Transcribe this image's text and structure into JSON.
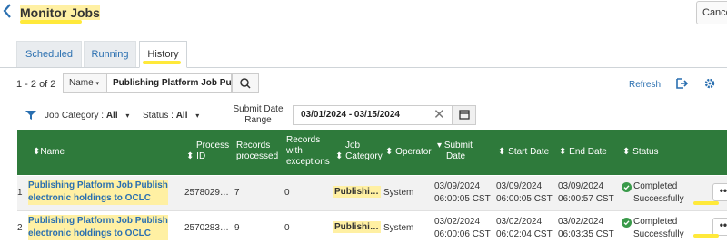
{
  "header": {
    "title": "Monitor Jobs",
    "cancel_label": "Cance"
  },
  "tabs": [
    {
      "label": "Scheduled",
      "active": false
    },
    {
      "label": "Running",
      "active": false
    },
    {
      "label": "History",
      "active": true
    }
  ],
  "toolbar": {
    "count_text": "1 - 2 of 2",
    "field_label": "Name",
    "search_value": "Publishing Platform Job Publ",
    "refresh_label": "Refresh"
  },
  "filters": {
    "job_category_label": "Job Category :",
    "job_category_value": "All",
    "status_label": "Status :",
    "status_value": "All",
    "submit_date_label_line1": "Submit Date",
    "submit_date_label_line2": "Range",
    "date_range": "03/01/2024 - 03/15/2024"
  },
  "table": {
    "columns": {
      "name": "Name",
      "process_id_1": "Process",
      "process_id_2": "ID",
      "records_processed_1": "Records",
      "records_processed_2": "processed",
      "records_exceptions_1": "Records",
      "records_exceptions_2": "with",
      "records_exceptions_3": "exceptions",
      "job_category_1": "Job",
      "job_category_2": "Category",
      "operator": "Operator",
      "submit_date_1": "Submit",
      "submit_date_2": "Date",
      "start_date": "Start Date",
      "end_date": "End Date",
      "status": "Status"
    },
    "rows": [
      {
        "num": "1",
        "name_line1": "Publishing Platform Job Publish",
        "name_line2": "electronic holdings to OCLC",
        "process_id": "2578029…",
        "records_processed": "7",
        "records_exceptions": "0",
        "job_category": "Publishi…",
        "operator": "System",
        "submit_date_1": "03/09/2024",
        "submit_date_2": "06:00:05 CST",
        "start_date_1": "03/09/2024",
        "start_date_2": "06:00:05 CST",
        "end_date_1": "03/09/2024",
        "end_date_2": "06:00:57 CST",
        "status_1": "Completed",
        "status_2": "Successfully",
        "more_label": "•••"
      },
      {
        "num": "2",
        "name_line1": "Publishing Platform Job Publish",
        "name_line2": "electronic holdings to OCLC",
        "process_id": "2570283…",
        "records_processed": "9",
        "records_exceptions": "0",
        "job_category": "Publishi…",
        "operator": "System",
        "submit_date_1": "03/02/2024",
        "submit_date_2": "06:00:06 CST",
        "start_date_1": "03/02/2024",
        "start_date_2": "06:02:04 CST",
        "end_date_1": "03/02/2024",
        "end_date_2": "06:03:35 CST",
        "status_1": "Completed",
        "status_2": "Successfully",
        "more_label": "•••"
      }
    ]
  },
  "colors": {
    "header_green": "#2e7a3b",
    "link_blue": "#2a6fb0",
    "highlight": "#fff0a3",
    "highlight_marker": "#ffe93a",
    "success_green": "#3a9a4a"
  },
  "icons": {
    "back": "chevron-left-icon",
    "search": "search-icon",
    "export": "export-icon",
    "settings": "gear-icon",
    "filter": "filter-icon",
    "clear": "close-icon",
    "calendar": "calendar-icon",
    "sort": "sort-icon",
    "status": "check-circle-icon",
    "more": "more-icon"
  }
}
